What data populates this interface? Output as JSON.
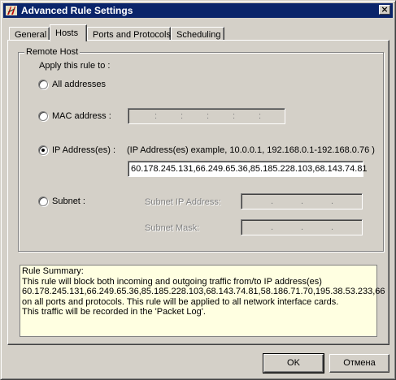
{
  "window": {
    "title": "Advanced Rule Settings",
    "close_label": "×"
  },
  "tabs": [
    {
      "label": "General"
    },
    {
      "label": "Hosts"
    },
    {
      "label": "Ports and Protocols"
    },
    {
      "label": "Scheduling"
    }
  ],
  "remote_host": {
    "group_label": "Remote Host",
    "apply_label": "Apply this rule to :",
    "all_addresses_label": "All addresses",
    "mac_label": "MAC address :",
    "ip_label": "IP Address(es) :",
    "ip_example": "(IP Address(es) example, 10.0.0.1, 192.168.0.1-192.168.0.76 )",
    "ip_value": "60.178.245.131,66.249.65.36,85.185.228.103,68.143.74.81",
    "subnet_label": "Subnet :",
    "subnet_ip_label": "Subnet IP Address:",
    "subnet_mask_label": "Subnet Mask:",
    "selected": "ip"
  },
  "summary": {
    "line1": "Rule Summary:",
    "line2": "This rule will block both incoming and outgoing traffic from/to IP address(es)",
    "line3": "60.178.245.131,66.249.65.36,85.185.228.103,68.143.74.81,58.186.71.70,195.38.53.233,66",
    "line4": "on all ports and protocols. This rule will be applied to all network interface cards.",
    "line5": "This traffic will be recorded in the 'Packet Log'."
  },
  "buttons": {
    "ok": "OK",
    "cancel": "Отмена"
  }
}
